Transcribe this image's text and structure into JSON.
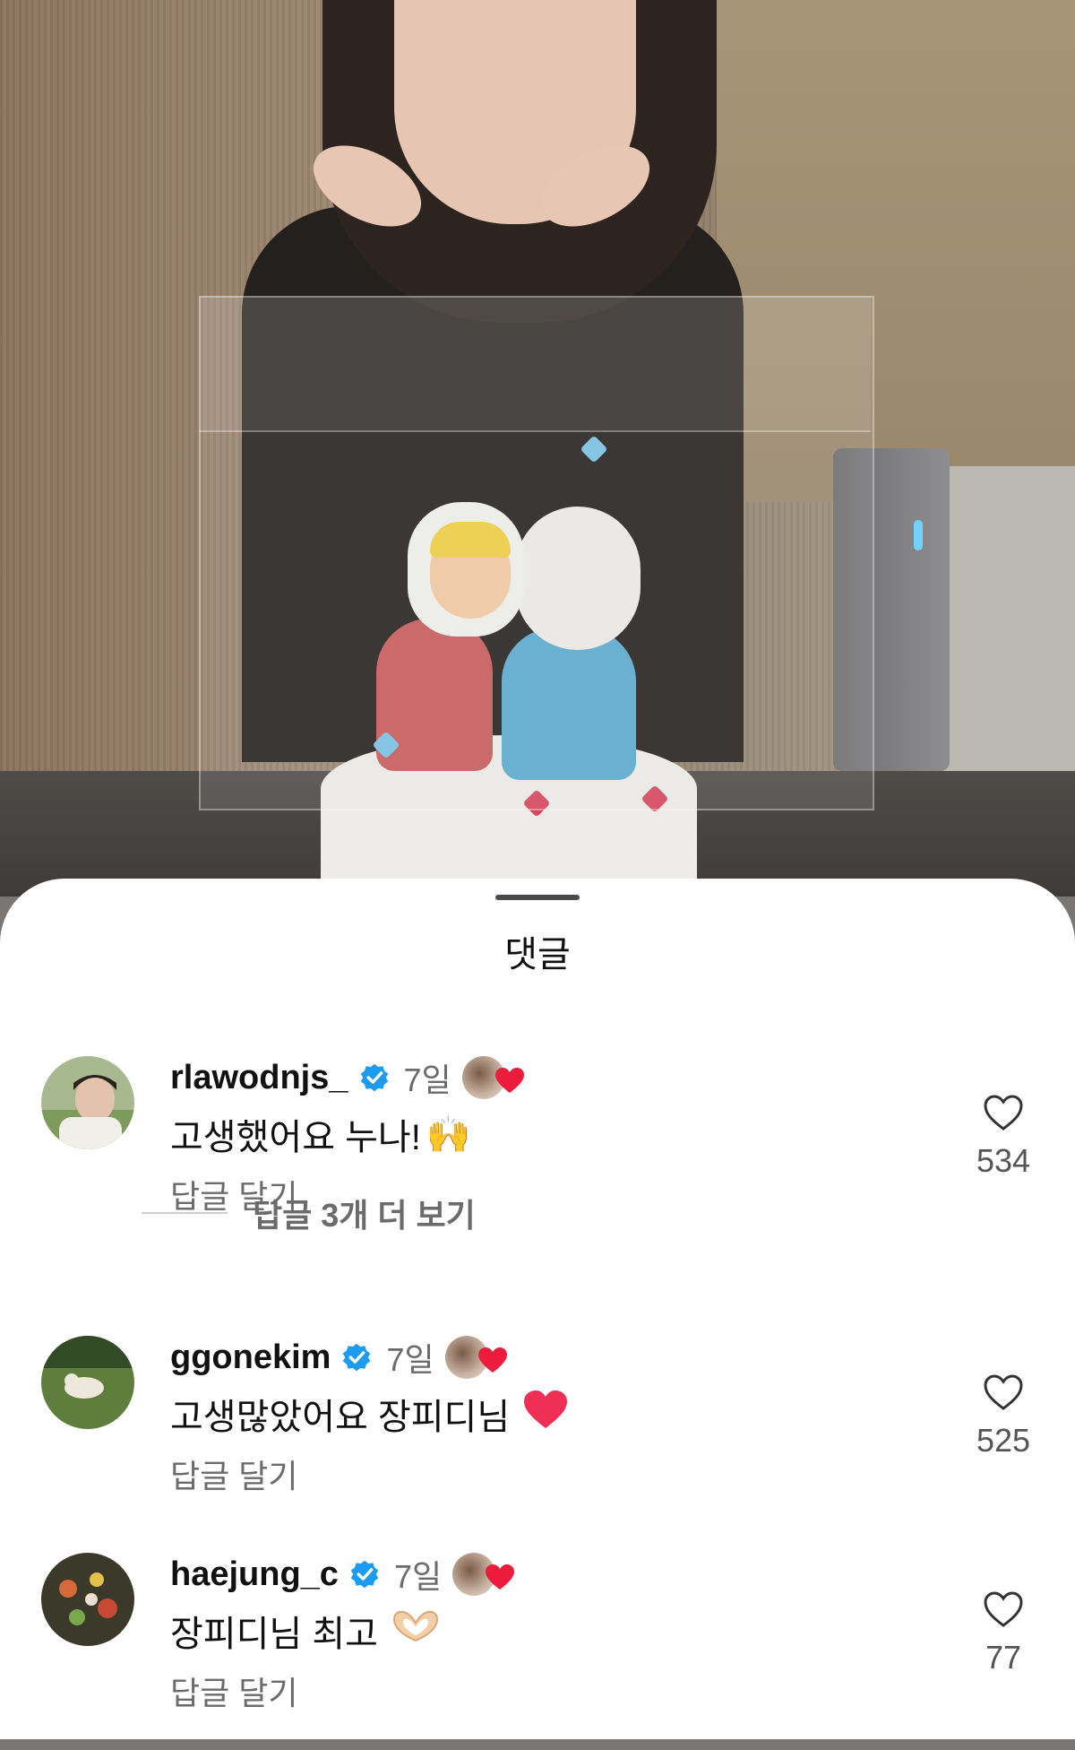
{
  "sheet": {
    "title": "댓글"
  },
  "comments": [
    {
      "username": "rlawodnjs_",
      "time": "7일",
      "text": "고생했어요 누나!",
      "emoji": "🙌",
      "reply_label": "답글 달기",
      "like_count": "534",
      "more_replies": "답글 3개 더 보기",
      "avatar_icon": "profile-photo-man",
      "verified_icon": "verified-badge-icon"
    },
    {
      "username": "ggonekim",
      "time": "7일",
      "text": "고생많았어요 장피디님",
      "emoji": "❤️",
      "reply_label": "답글 달기",
      "like_count": "525",
      "avatar_icon": "profile-photo-dog-on-grass",
      "verified_icon": "verified-badge-icon"
    },
    {
      "username": "haejung_c",
      "time": "7일",
      "text": "장피디님 최고",
      "emoji": "🫶",
      "reply_label": "답글 달기",
      "like_count": "77",
      "avatar_icon": "profile-photo-flowers",
      "verified_icon": "verified-badge-icon"
    }
  ],
  "colors": {
    "verified": "#1d9bf0",
    "creator_heart": "#ed1c3c",
    "muted_text": "#6b6b6b"
  }
}
